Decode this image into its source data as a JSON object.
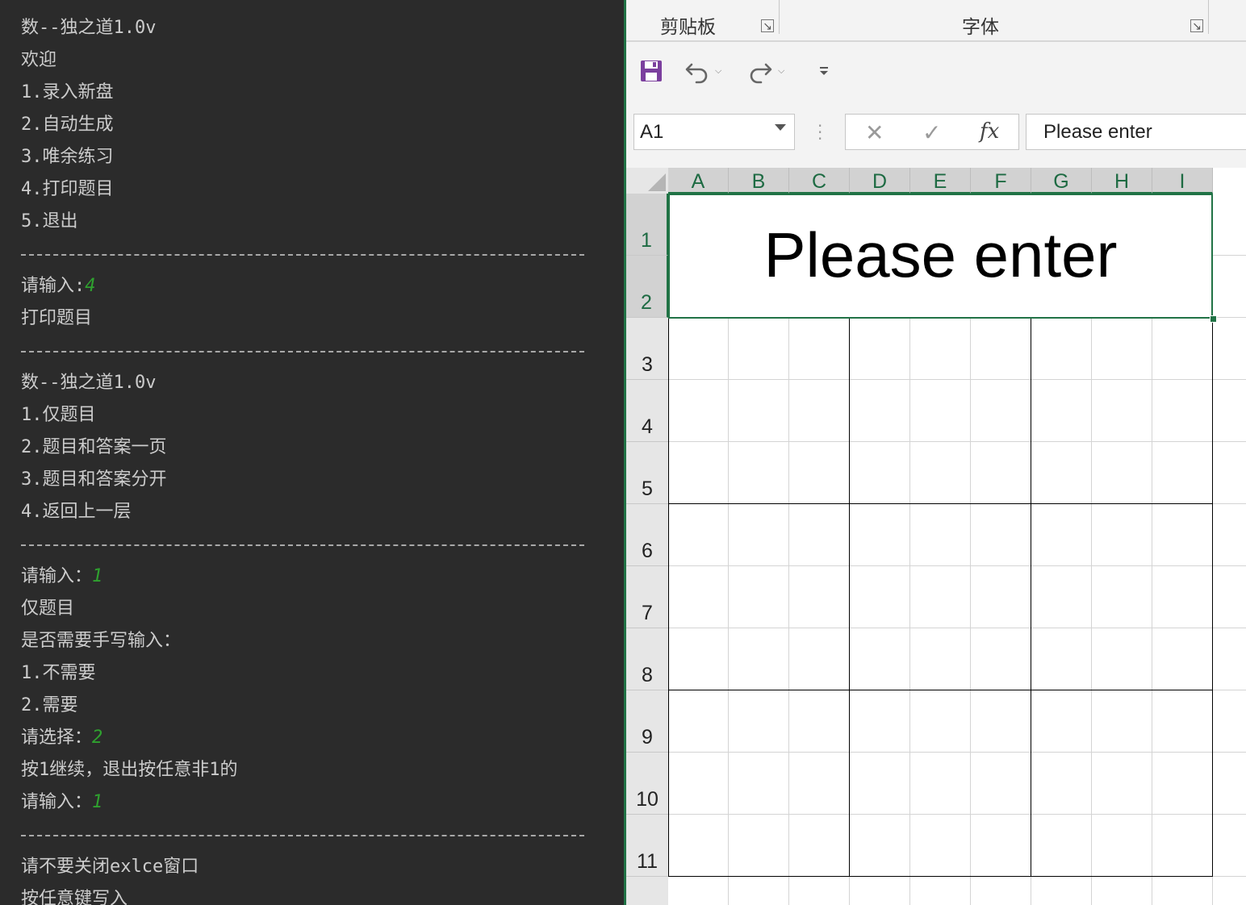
{
  "console": {
    "lines": [
      {
        "text": "数--独之道1.0v"
      },
      {
        "text": "欢迎"
      },
      {
        "text": "1.录入新盘"
      },
      {
        "text": "2.自动生成"
      },
      {
        "text": "3.唯余练习"
      },
      {
        "text": "4.打印题目"
      },
      {
        "text": "5.退出"
      },
      {
        "sep": true
      },
      {
        "text": "请输入:",
        "input": "4"
      },
      {
        "text": "打印题目"
      },
      {
        "sep": true
      },
      {
        "text": "数--独之道1.0v"
      },
      {
        "text": "1.仅题目"
      },
      {
        "text": "2.题目和答案一页"
      },
      {
        "text": "3.题目和答案分开"
      },
      {
        "text": "4.返回上一层"
      },
      {
        "sep": true
      },
      {
        "text": "请输入：",
        "input": "1"
      },
      {
        "text": "仅题目"
      },
      {
        "text": "是否需要手写输入："
      },
      {
        "text": "1.不需要"
      },
      {
        "text": "2.需要"
      },
      {
        "text": "请选择：",
        "input": "2"
      },
      {
        "text": "按1继续，退出按任意非1的"
      },
      {
        "text": "请输入：",
        "input": "1"
      },
      {
        "sep": true
      },
      {
        "text": "请不要关闭exlce窗口"
      },
      {
        "text": "按任意键写入"
      }
    ],
    "colors": {
      "background": "#2b2b2b",
      "text": "#cccccc",
      "input": "#2fa12f"
    }
  },
  "excel": {
    "ribbon": {
      "clipboard_label": "剪贴板",
      "font_label": "字体",
      "launcher_glyph": "↘"
    },
    "qat": {
      "save_icon": "save-icon",
      "undo_icon": "undo-icon",
      "redo_icon": "redo-icon",
      "customize_icon": "customize-qat-icon"
    },
    "formula_bar": {
      "name_box": "A1",
      "cancel_glyph": "✕",
      "enter_glyph": "✓",
      "fx_label": "fx",
      "content": "Please enter"
    },
    "columns": [
      "A",
      "B",
      "C",
      "D",
      "E",
      "F",
      "G",
      "H",
      "I"
    ],
    "rows": [
      "1",
      "2",
      "3",
      "4",
      "5",
      "6",
      "7",
      "8",
      "9",
      "10",
      "11"
    ],
    "merged_cell_text": "Please enter",
    "accent_color": "#217346"
  }
}
